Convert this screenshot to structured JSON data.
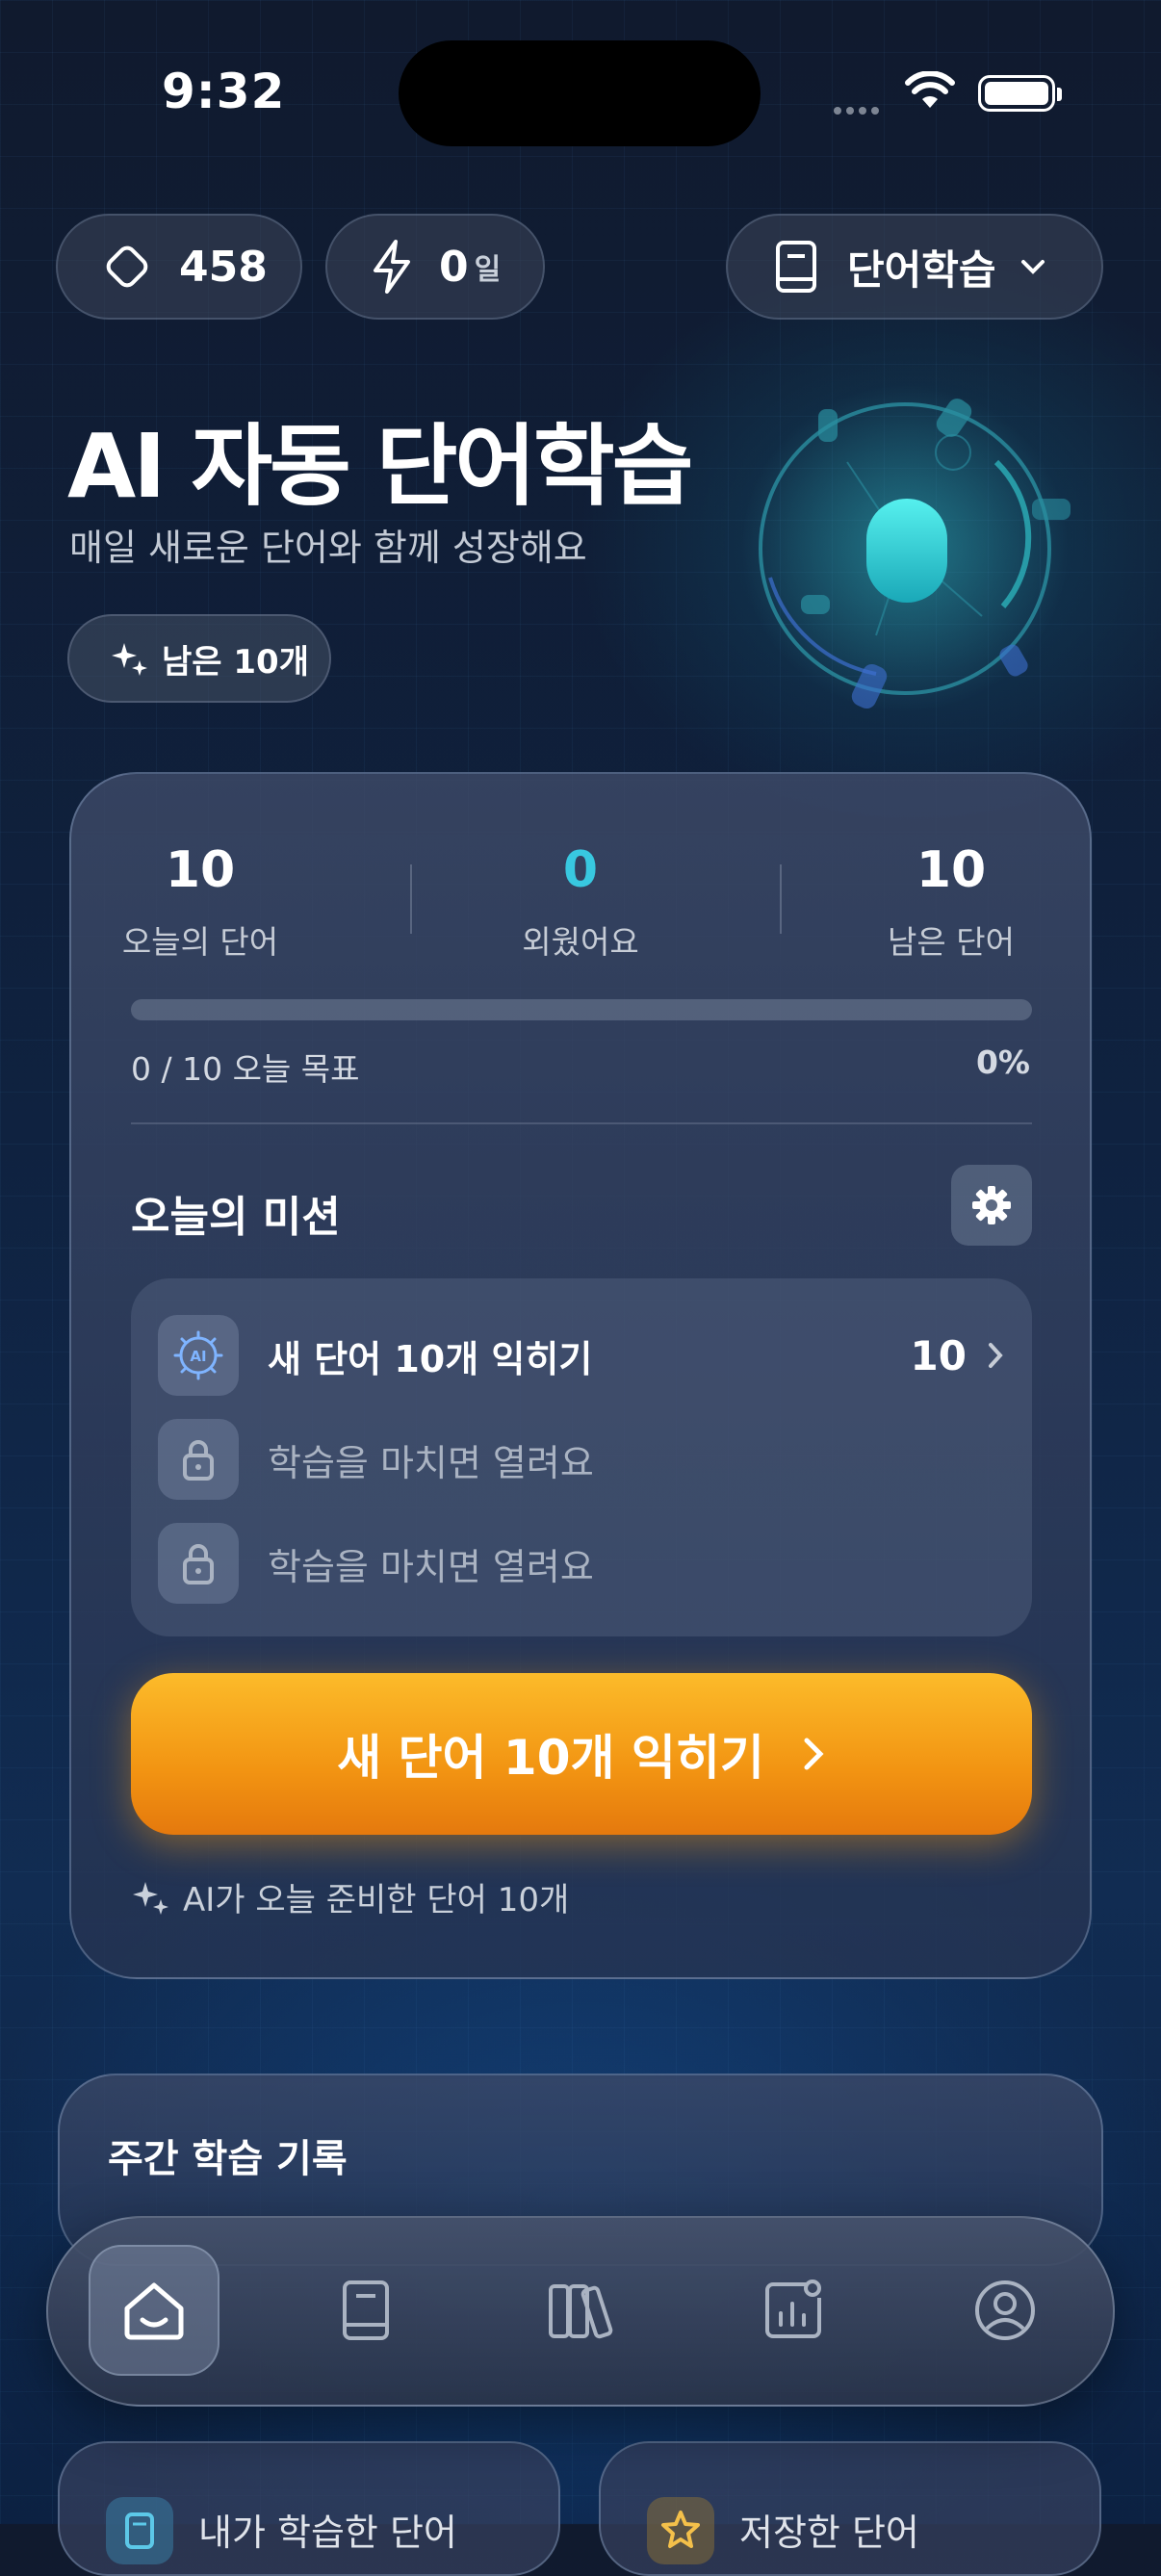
{
  "status": {
    "time": "9:32"
  },
  "header": {
    "gems": "458",
    "streak_value": "0",
    "streak_unit": "일",
    "mode": "단어학습"
  },
  "hero": {
    "title": "AI 자동 단어학습",
    "subtitle": "매일 새로운 단어와 함께 성장해요",
    "remaining_chip": "남은 10개"
  },
  "stats": [
    {
      "value": "10",
      "label": "오늘의 단어"
    },
    {
      "value": "0",
      "label": "외웠어요"
    },
    {
      "value": "10",
      "label": "남은 단어"
    }
  ],
  "progress": {
    "fraction": 0.0,
    "goal_text": "0 / 10 오늘 목표",
    "percent_text": "0%"
  },
  "mission": {
    "title": "오늘의 미션",
    "items": [
      {
        "text": "새 단어 10개 익히기",
        "count": "10",
        "icon": "ai-chip-icon",
        "locked": false
      },
      {
        "text": "학습을 마치면 열려요",
        "icon": "lock-icon",
        "locked": true
      },
      {
        "text": "학습을 마치면 열려요",
        "icon": "lock-icon",
        "locked": true
      }
    ]
  },
  "cta": {
    "label": "새 단어 10개 익히기"
  },
  "ai_note": "AI가 오늘 준비한 단어 10개",
  "weekly": {
    "title": "주간 학습 기록"
  },
  "bottom_cards": [
    {
      "label": "내가 학습한 단어",
      "icon": "note-icon"
    },
    {
      "label": "저장한 단어",
      "icon": "star-icon"
    }
  ],
  "tabs": [
    {
      "name": "home",
      "icon": "home-icon",
      "active": true
    },
    {
      "name": "book",
      "icon": "book-icon",
      "active": false
    },
    {
      "name": "library",
      "icon": "library-icon",
      "active": false
    },
    {
      "name": "stats",
      "icon": "chart-icon",
      "active": false
    },
    {
      "name": "profile",
      "icon": "profile-icon",
      "active": false
    }
  ],
  "colors": {
    "accent_cyan": "#38c8e0",
    "cta_orange": "#f29412",
    "background": "#0f2240"
  }
}
